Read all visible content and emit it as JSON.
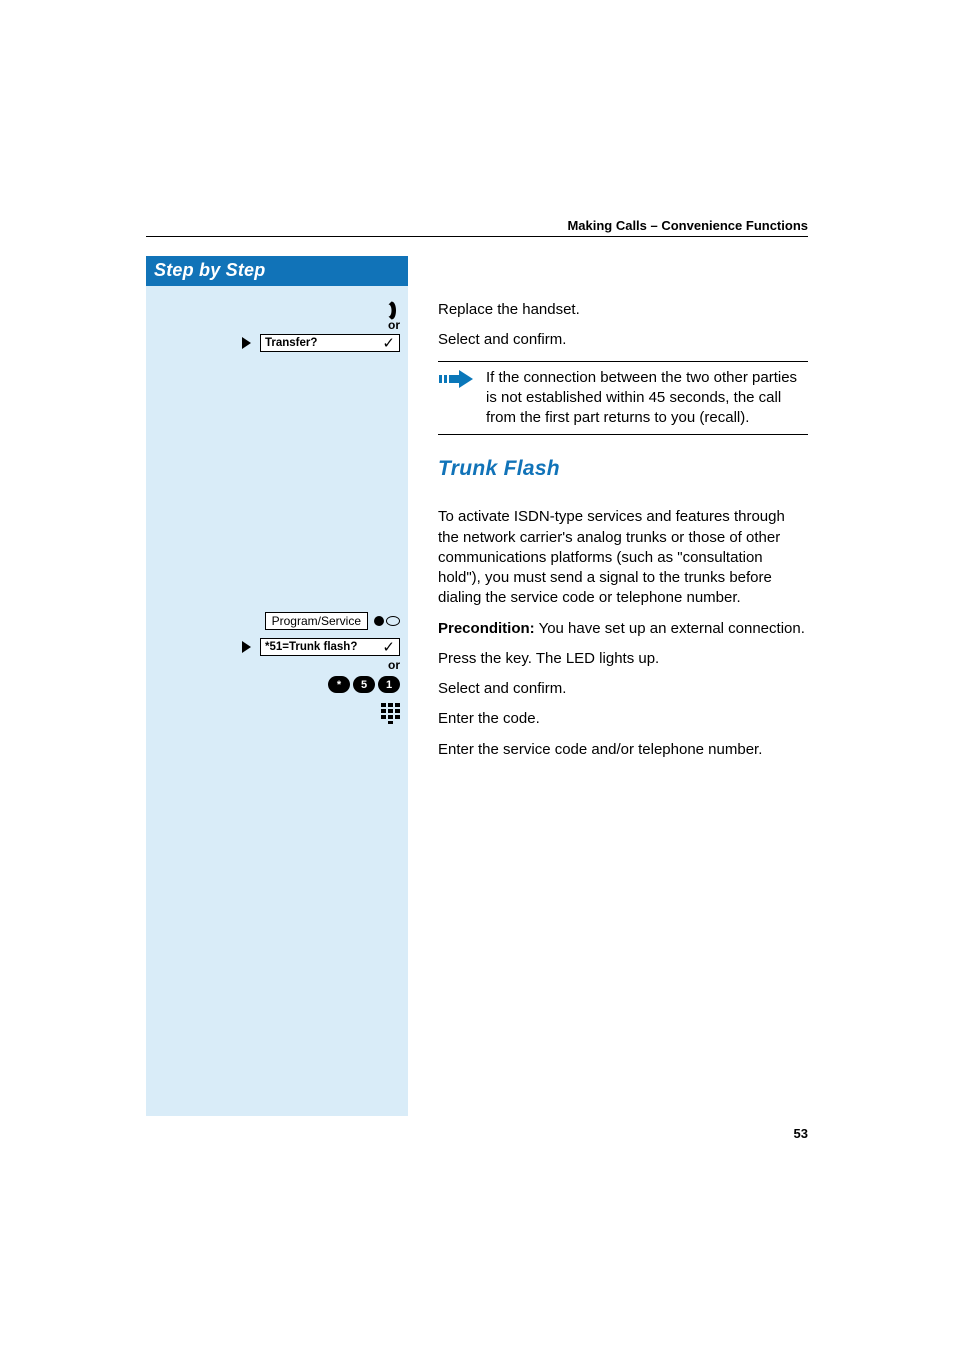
{
  "header": {
    "section": "Making Calls – Convenience Functions"
  },
  "step_panel": {
    "title": "Step by Step"
  },
  "side": {
    "or1": "or",
    "transfer_label": "Transfer?",
    "program_service": "Program/Service",
    "trunk_flash_label": "*51=Trunk flash?",
    "or2": "or",
    "keys": {
      "k1": "*",
      "k2": "5",
      "k3": "1"
    }
  },
  "main": {
    "replace_handset": "Replace the handset.",
    "select_confirm_1": "Select and confirm.",
    "note": "If the connection between the two other parties is not established within 45 seconds, the call from the first part returns to you (recall).",
    "h2_trunk_flash": "Trunk Flash",
    "trunk_para": "To activate ISDN-type services and features through the network carrier's analog trunks or those of other communications platforms (such as \"consultation hold\"), you must send a signal to the trunks before dialing the service code or telephone number.",
    "precondition_label": "Precondition:",
    "precondition_rest": " You have set up an external connection.",
    "press_key": "Press the key. The LED lights up.",
    "select_confirm_2": "Select and confirm.",
    "enter_code": "Enter the code.",
    "enter_service": "Enter the service code and/or telephone number."
  },
  "footer": {
    "page": "53"
  }
}
